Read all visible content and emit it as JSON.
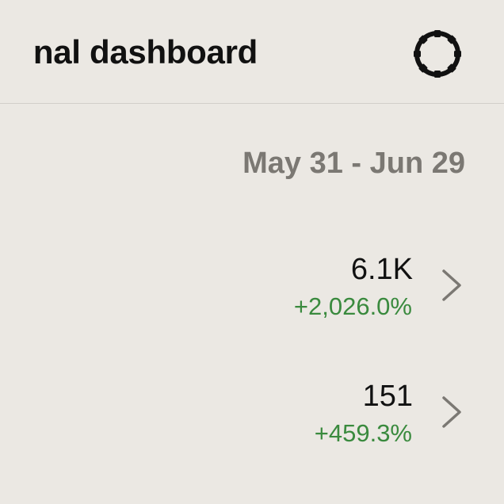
{
  "header": {
    "title": "nal dashboard",
    "settings_icon": "gear-icon"
  },
  "date_range": "May 31 - Jun 29",
  "metrics": [
    {
      "value": "6.1K",
      "change": "+2,026.0%",
      "icon": "chevron-right-icon"
    },
    {
      "value": "151",
      "change": "+459.3%",
      "icon": "chevron-right-icon"
    }
  ],
  "colors": {
    "background": "#ebe8e3",
    "positive_change": "#3a8a3e",
    "muted_text": "#7b7873",
    "chevron": "#7b7873"
  }
}
